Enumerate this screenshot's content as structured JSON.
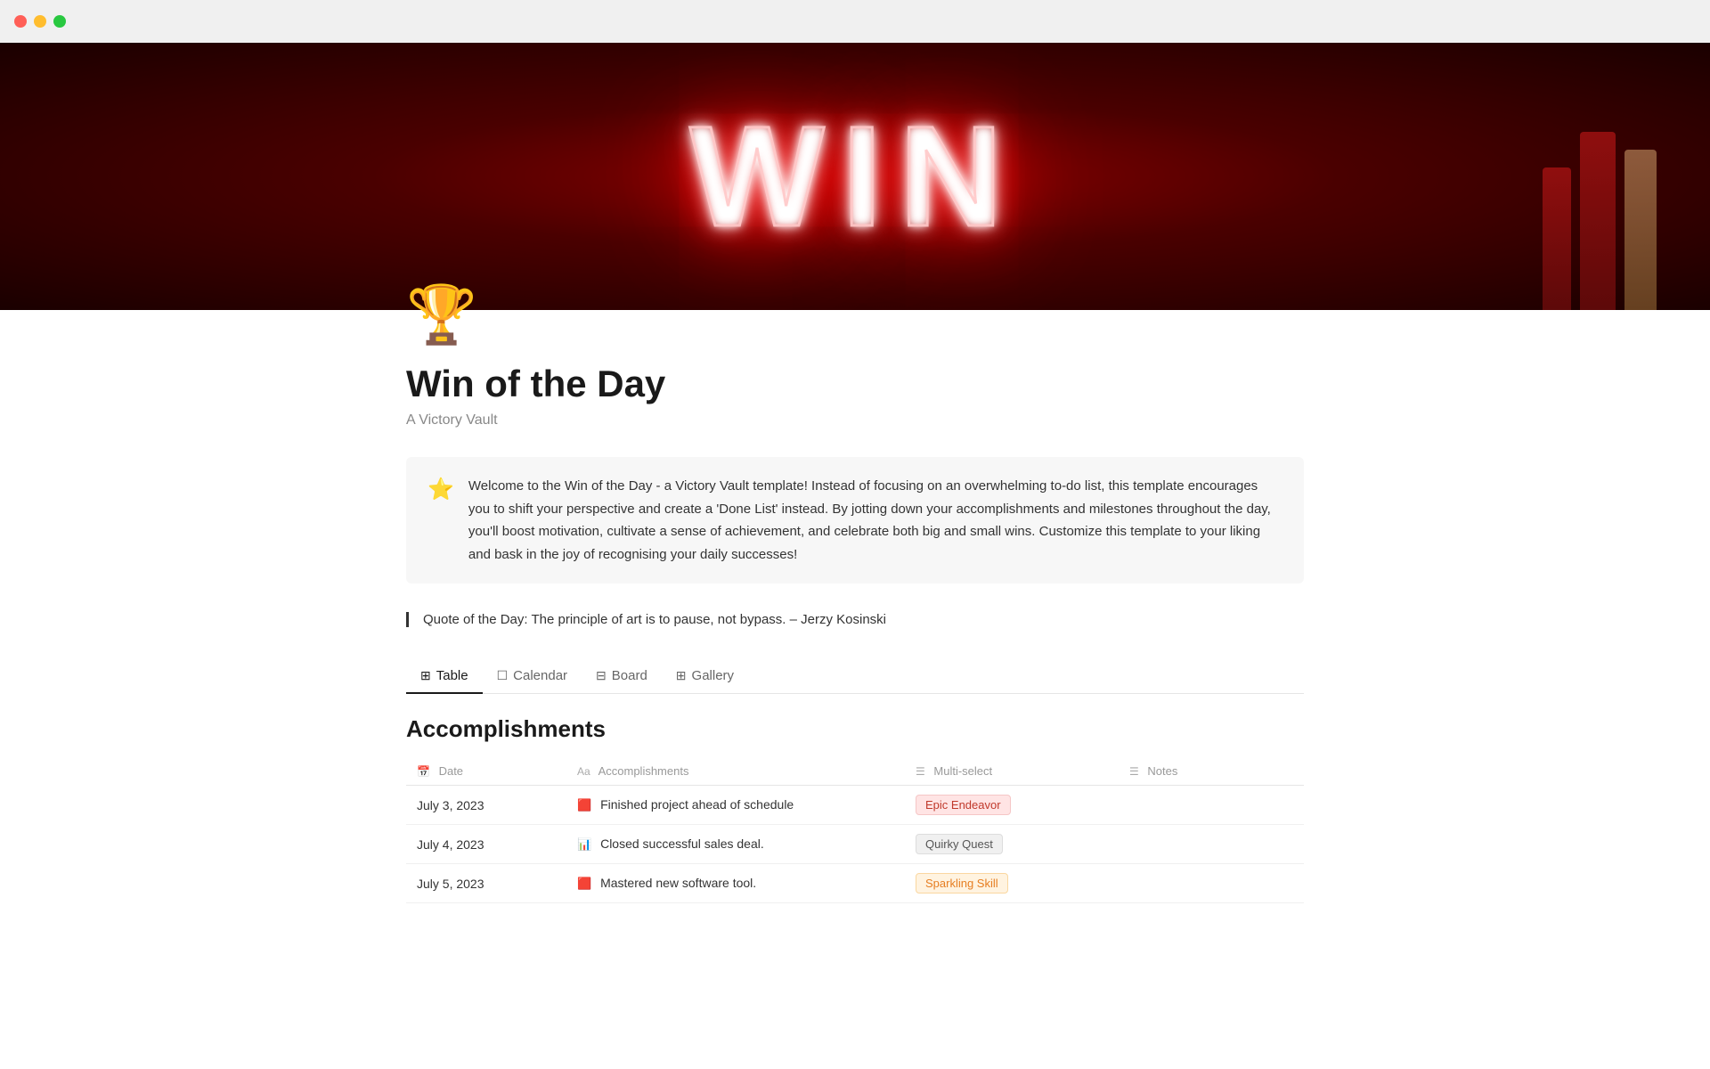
{
  "titlebar": {
    "buttons": [
      "close",
      "minimize",
      "maximize"
    ]
  },
  "hero": {
    "neon_text": "WIN"
  },
  "page": {
    "icon": "🏆",
    "title": "Win of the Day",
    "subtitle": "A Victory Vault",
    "callout": {
      "icon": "⭐",
      "text": "Welcome to the Win of the Day - a Victory Vault template! Instead of focusing on an overwhelming to-do list, this template encourages you to shift your perspective and create a 'Done List' instead. By jotting down your accomplishments and milestones throughout the day, you'll boost motivation, cultivate a sense of achievement, and celebrate both big and small wins. Customize this template to your liking and bask in the joy of recognising your daily successes!"
    },
    "quote": "Quote of the Day: The principle of art is to pause, not bypass. – Jerzy Kosinski"
  },
  "tabs": [
    {
      "label": "Table",
      "icon": "⊞",
      "active": true
    },
    {
      "label": "Calendar",
      "icon": "☐",
      "active": false
    },
    {
      "label": "Board",
      "icon": "⊟",
      "active": false
    },
    {
      "label": "Gallery",
      "icon": "⊞",
      "active": false
    }
  ],
  "table": {
    "heading": "Accomplishments",
    "columns": [
      {
        "icon": "📅",
        "label": "Date"
      },
      {
        "icon": "Aa",
        "label": "Accomplishments"
      },
      {
        "icon": "☰",
        "label": "Multi-select"
      },
      {
        "icon": "☰",
        "label": "Notes"
      }
    ],
    "rows": [
      {
        "date": "July 3, 2023",
        "accomplishment": "Finished project ahead of schedule",
        "row_icon": "🟥",
        "tag": "Epic Endeavor",
        "tag_class": "tag-epic",
        "notes": ""
      },
      {
        "date": "July 4, 2023",
        "accomplishment": "Closed successful sales deal.",
        "row_icon": "📊",
        "tag": "Quirky Quest",
        "tag_class": "tag-quirky",
        "notes": ""
      },
      {
        "date": "July 5, 2023",
        "accomplishment": "Mastered new software tool.",
        "row_icon": "🟥",
        "tag": "Sparkling Skill",
        "tag_class": "tag-sparkling",
        "notes": ""
      }
    ]
  }
}
